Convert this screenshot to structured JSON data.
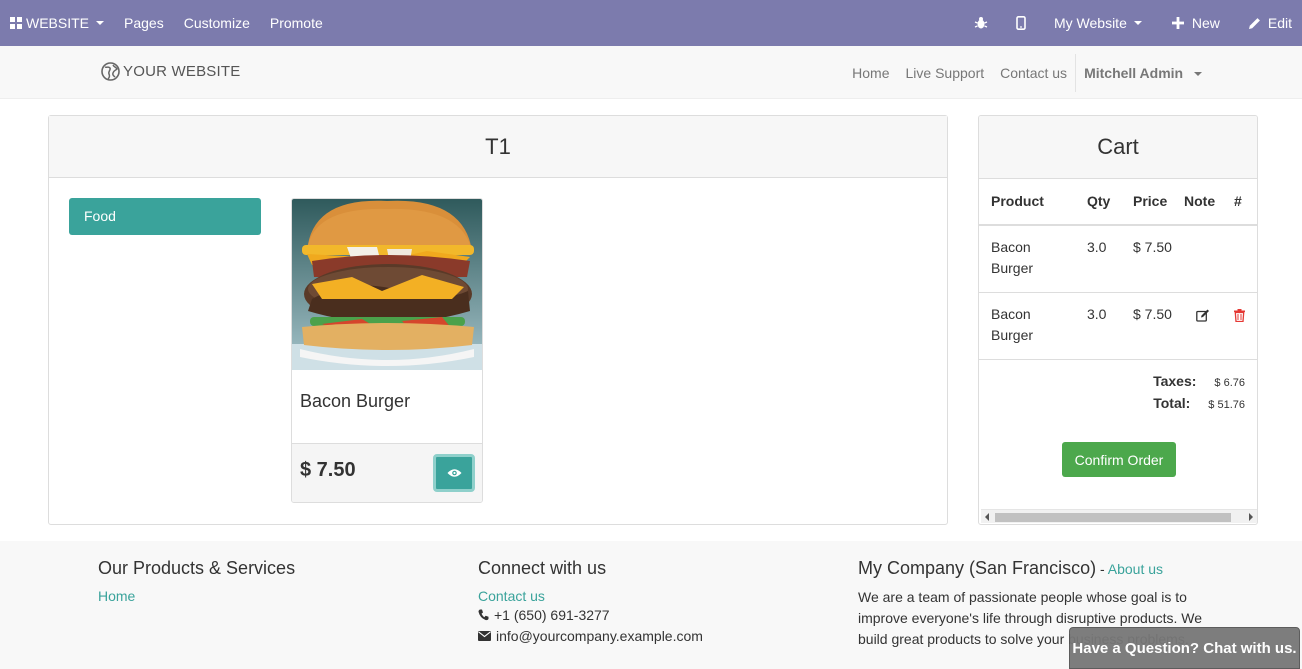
{
  "adminbar": {
    "app_menu": "WEBSITE",
    "menu": [
      "Pages",
      "Customize",
      "Promote"
    ],
    "website_switch": "My Website",
    "new_label": "New",
    "edit_label": "Edit"
  },
  "header": {
    "logo_text": "YOUR WEBSITE",
    "nav": [
      "Home",
      "Live Support",
      "Contact us"
    ],
    "user": "Mitchell Admin"
  },
  "pos": {
    "title": "T1",
    "category": "Food",
    "product": {
      "name": "Bacon Burger",
      "price": "$ 7.50"
    }
  },
  "cart": {
    "title": "Cart",
    "columns": [
      "Product",
      "Qty",
      "Price",
      "Note",
      "#"
    ],
    "rows": [
      {
        "product": "Bacon Burger",
        "qty": "3.0",
        "price": "$ 7.50"
      },
      {
        "product": "Bacon Burger",
        "qty": "3.0",
        "price": "$ 7.50"
      }
    ],
    "taxes_label": "Taxes:",
    "taxes_value": "$ 6.76",
    "total_label": "Total:",
    "total_value": "$ 51.76",
    "confirm_label": "Confirm Order"
  },
  "footer": {
    "products_title": "Our Products & Services",
    "products_link": "Home",
    "connect_title": "Connect with us",
    "contact_link": "Contact us",
    "phone": "+1 (650) 691-3277",
    "email": "info@yourcompany.example.com",
    "company_title": "My Company (San Francisco)",
    "company_sep": " - ",
    "about_link": "About us",
    "company_text": "We are a team of passionate people whose goal is to improve everyone's life through disruptive products. We build great products to solve your business problems."
  },
  "chat": {
    "label": "Have a Question? Chat with us."
  },
  "colors": {
    "adminbar": "#7c7bad",
    "accent": "#3aa39b",
    "confirm": "#4ca84c",
    "delete": "#e53935"
  }
}
